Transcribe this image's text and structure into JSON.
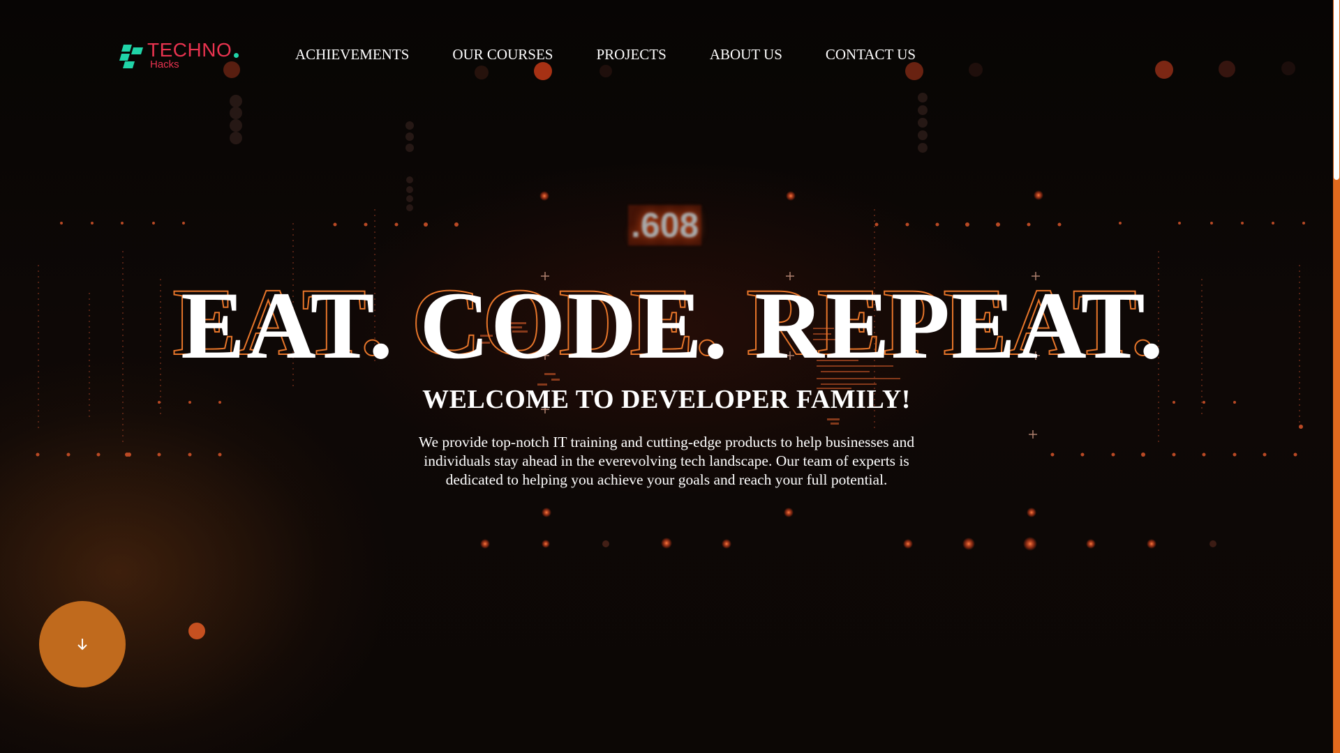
{
  "brand": {
    "name": "TECHNO",
    "sub": "Hacks",
    "logo_icon": "logo-blocks-icon",
    "colors": {
      "name": "#e8334f",
      "mark": "#20d4a8"
    }
  },
  "nav": {
    "items": [
      {
        "label": "ACHIEVEMENTS"
      },
      {
        "label": "OUR COURSES"
      },
      {
        "label": "PROJECTS"
      },
      {
        "label": "ABOUT US"
      },
      {
        "label": "CONTACT US"
      }
    ]
  },
  "hero": {
    "background_code": ".608",
    "headline": "EAT. CODE. REPEAT.",
    "subheadline": "WELCOME TO DEVELOPER FAMILY!",
    "description": "We provide top-notch IT training and cutting-edge products to help businesses and individuals stay ahead in the everevolving tech landscape. Our team of experts is dedicated to helping you achieve your goals and reach your full potential."
  },
  "scroll_button": {
    "icon": "arrow-down-icon",
    "color": "#c06a1d"
  },
  "theme": {
    "accent": "#e8762a",
    "background": "#0a0706"
  }
}
